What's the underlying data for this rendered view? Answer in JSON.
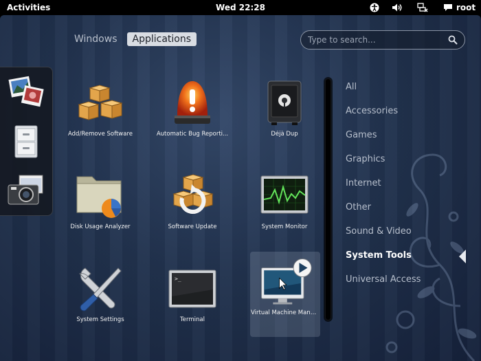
{
  "topbar": {
    "activities": "Activities",
    "clock": "Wed 22:28",
    "user": "root"
  },
  "view_selector": {
    "windows": "Windows",
    "applications": "Applications",
    "active": "Applications"
  },
  "search": {
    "placeholder": "Type to search..."
  },
  "dash": [
    "image-viewer-icon",
    "file-cabinet-icon",
    "camera-icon"
  ],
  "apps": [
    {
      "label": "Add/Remove Software",
      "icon": "boxes-icon"
    },
    {
      "label": "Automatic Bug Reporti...",
      "icon": "alert-beacon-icon"
    },
    {
      "label": "Déjà Dup",
      "icon": "safe-icon"
    },
    {
      "label": "Disk Usage Analyzer",
      "icon": "folder-pie-icon"
    },
    {
      "label": "Software Update",
      "icon": "update-boxes-icon"
    },
    {
      "label": "System Monitor",
      "icon": "monitor-graph-icon"
    },
    {
      "label": "System Settings",
      "icon": "tools-icon"
    },
    {
      "label": "Terminal",
      "icon": "terminal-icon"
    },
    {
      "label": "Virtual Machine Manager",
      "icon": "virtual-machine-icon"
    }
  ],
  "categories": [
    "All",
    "Accessories",
    "Games",
    "Graphics",
    "Internet",
    "Other",
    "Sound & Video",
    "System Tools",
    "Universal Access"
  ],
  "selected_category": "System Tools",
  "colors": {
    "panel": "#000000",
    "accent_bg": "#22334f",
    "tab_active": "#d9dde3"
  }
}
